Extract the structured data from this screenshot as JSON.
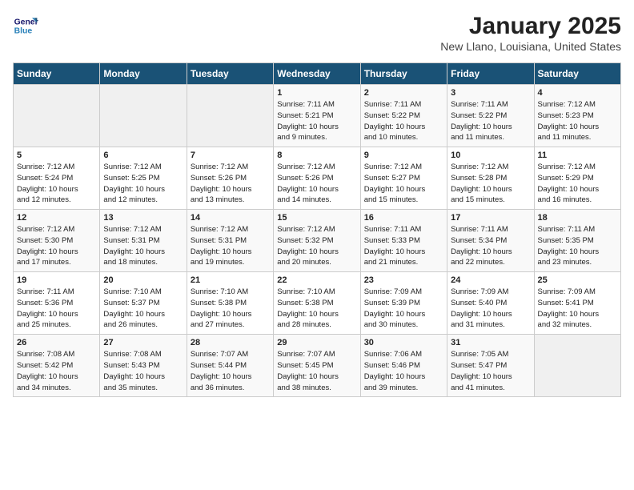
{
  "header": {
    "logo_line1": "General",
    "logo_line2": "Blue",
    "month": "January 2025",
    "location": "New Llano, Louisiana, United States"
  },
  "weekdays": [
    "Sunday",
    "Monday",
    "Tuesday",
    "Wednesday",
    "Thursday",
    "Friday",
    "Saturday"
  ],
  "weeks": [
    [
      {
        "day": "",
        "info": ""
      },
      {
        "day": "",
        "info": ""
      },
      {
        "day": "",
        "info": ""
      },
      {
        "day": "1",
        "info": "Sunrise: 7:11 AM\nSunset: 5:21 PM\nDaylight: 10 hours\nand 9 minutes."
      },
      {
        "day": "2",
        "info": "Sunrise: 7:11 AM\nSunset: 5:22 PM\nDaylight: 10 hours\nand 10 minutes."
      },
      {
        "day": "3",
        "info": "Sunrise: 7:11 AM\nSunset: 5:22 PM\nDaylight: 10 hours\nand 11 minutes."
      },
      {
        "day": "4",
        "info": "Sunrise: 7:12 AM\nSunset: 5:23 PM\nDaylight: 10 hours\nand 11 minutes."
      }
    ],
    [
      {
        "day": "5",
        "info": "Sunrise: 7:12 AM\nSunset: 5:24 PM\nDaylight: 10 hours\nand 12 minutes."
      },
      {
        "day": "6",
        "info": "Sunrise: 7:12 AM\nSunset: 5:25 PM\nDaylight: 10 hours\nand 12 minutes."
      },
      {
        "day": "7",
        "info": "Sunrise: 7:12 AM\nSunset: 5:26 PM\nDaylight: 10 hours\nand 13 minutes."
      },
      {
        "day": "8",
        "info": "Sunrise: 7:12 AM\nSunset: 5:26 PM\nDaylight: 10 hours\nand 14 minutes."
      },
      {
        "day": "9",
        "info": "Sunrise: 7:12 AM\nSunset: 5:27 PM\nDaylight: 10 hours\nand 15 minutes."
      },
      {
        "day": "10",
        "info": "Sunrise: 7:12 AM\nSunset: 5:28 PM\nDaylight: 10 hours\nand 15 minutes."
      },
      {
        "day": "11",
        "info": "Sunrise: 7:12 AM\nSunset: 5:29 PM\nDaylight: 10 hours\nand 16 minutes."
      }
    ],
    [
      {
        "day": "12",
        "info": "Sunrise: 7:12 AM\nSunset: 5:30 PM\nDaylight: 10 hours\nand 17 minutes."
      },
      {
        "day": "13",
        "info": "Sunrise: 7:12 AM\nSunset: 5:31 PM\nDaylight: 10 hours\nand 18 minutes."
      },
      {
        "day": "14",
        "info": "Sunrise: 7:12 AM\nSunset: 5:31 PM\nDaylight: 10 hours\nand 19 minutes."
      },
      {
        "day": "15",
        "info": "Sunrise: 7:12 AM\nSunset: 5:32 PM\nDaylight: 10 hours\nand 20 minutes."
      },
      {
        "day": "16",
        "info": "Sunrise: 7:11 AM\nSunset: 5:33 PM\nDaylight: 10 hours\nand 21 minutes."
      },
      {
        "day": "17",
        "info": "Sunrise: 7:11 AM\nSunset: 5:34 PM\nDaylight: 10 hours\nand 22 minutes."
      },
      {
        "day": "18",
        "info": "Sunrise: 7:11 AM\nSunset: 5:35 PM\nDaylight: 10 hours\nand 23 minutes."
      }
    ],
    [
      {
        "day": "19",
        "info": "Sunrise: 7:11 AM\nSunset: 5:36 PM\nDaylight: 10 hours\nand 25 minutes."
      },
      {
        "day": "20",
        "info": "Sunrise: 7:10 AM\nSunset: 5:37 PM\nDaylight: 10 hours\nand 26 minutes."
      },
      {
        "day": "21",
        "info": "Sunrise: 7:10 AM\nSunset: 5:38 PM\nDaylight: 10 hours\nand 27 minutes."
      },
      {
        "day": "22",
        "info": "Sunrise: 7:10 AM\nSunset: 5:38 PM\nDaylight: 10 hours\nand 28 minutes."
      },
      {
        "day": "23",
        "info": "Sunrise: 7:09 AM\nSunset: 5:39 PM\nDaylight: 10 hours\nand 30 minutes."
      },
      {
        "day": "24",
        "info": "Sunrise: 7:09 AM\nSunset: 5:40 PM\nDaylight: 10 hours\nand 31 minutes."
      },
      {
        "day": "25",
        "info": "Sunrise: 7:09 AM\nSunset: 5:41 PM\nDaylight: 10 hours\nand 32 minutes."
      }
    ],
    [
      {
        "day": "26",
        "info": "Sunrise: 7:08 AM\nSunset: 5:42 PM\nDaylight: 10 hours\nand 34 minutes."
      },
      {
        "day": "27",
        "info": "Sunrise: 7:08 AM\nSunset: 5:43 PM\nDaylight: 10 hours\nand 35 minutes."
      },
      {
        "day": "28",
        "info": "Sunrise: 7:07 AM\nSunset: 5:44 PM\nDaylight: 10 hours\nand 36 minutes."
      },
      {
        "day": "29",
        "info": "Sunrise: 7:07 AM\nSunset: 5:45 PM\nDaylight: 10 hours\nand 38 minutes."
      },
      {
        "day": "30",
        "info": "Sunrise: 7:06 AM\nSunset: 5:46 PM\nDaylight: 10 hours\nand 39 minutes."
      },
      {
        "day": "31",
        "info": "Sunrise: 7:05 AM\nSunset: 5:47 PM\nDaylight: 10 hours\nand 41 minutes."
      },
      {
        "day": "",
        "info": ""
      }
    ]
  ]
}
